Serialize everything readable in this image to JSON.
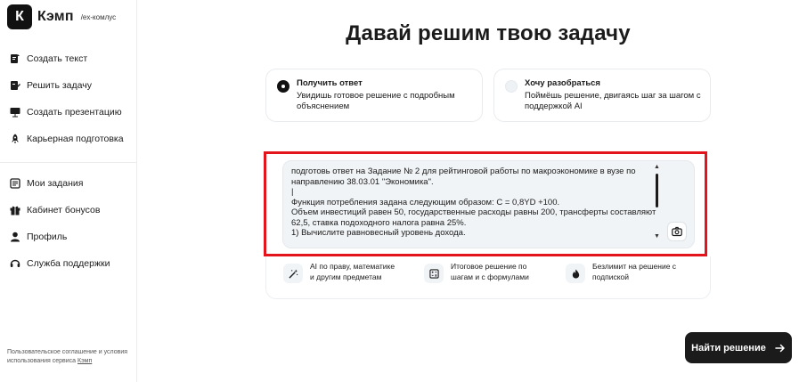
{
  "brand": {
    "logo_letter": "К",
    "name": "Кэмп",
    "sub": "/ex-комлус"
  },
  "sidebar": {
    "top_items": [
      {
        "label": "Создать текст",
        "icon": "create-text-icon"
      },
      {
        "label": "Решить задачу",
        "icon": "solve-task-icon"
      },
      {
        "label": "Создать презентацию",
        "icon": "presentation-icon"
      },
      {
        "label": "Карьерная подготовка",
        "icon": "rocket-icon"
      }
    ],
    "bottom_items": [
      {
        "label": "Мои задания",
        "icon": "tasks-icon"
      },
      {
        "label": "Кабинет бонусов",
        "icon": "bonus-icon"
      },
      {
        "label": "Профиль",
        "icon": "profile-icon"
      },
      {
        "label": "Служба поддержки",
        "icon": "headset-icon"
      }
    ],
    "legal_text": "Пользовательское соглашение и условия использования сервиса",
    "legal_link": "Кэмп"
  },
  "main": {
    "title": "Давай решим твою задачу",
    "modes": [
      {
        "title": "Получить ответ",
        "desc": "Увидишь готовое решение с подробным объяснением",
        "selected": true
      },
      {
        "title": "Хочу разобраться",
        "desc": "Поймёшь решение, двигаясь шаг за шагом с поддержкой AI",
        "selected": false
      }
    ],
    "task_text": "подготовь ответ на Задание № 2 для рейтинговой работы по макроэкономике в вузе по направлению 38.03.01 \"Экономика\".\n|\nФункция потребления задана следующим образом: С = 0,8YD +100.\nОбъем инвестиций равен 50, государственные расходы равны 200, трансферты составляют 62,5, ставка подоходного налога равна 25%.\n1) Вычислите равновесный уровень дохода.",
    "features": [
      {
        "text": "AI по праву, математике и другим предметам",
        "icon": "magic-wand-icon"
      },
      {
        "text": "Итоговое решение по шагам и с формулами",
        "icon": "formula-icon"
      },
      {
        "text": "Безлимит на решение с подпиской",
        "icon": "flame-icon"
      }
    ],
    "submit_label": "Найти решение"
  },
  "colors": {
    "accent": "#1b1b1b",
    "highlight_frame": "#e3141b",
    "input_bg": "#f1f4f6"
  }
}
